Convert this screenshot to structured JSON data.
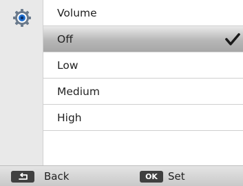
{
  "menu": {
    "title": "Volume",
    "options": [
      {
        "label": "Off",
        "selected": true
      },
      {
        "label": "Low",
        "selected": false
      },
      {
        "label": "Medium",
        "selected": false
      },
      {
        "label": "High",
        "selected": false
      }
    ],
    "category_icon": "settings-icon"
  },
  "footer": {
    "back_key_icon": "return-arrow-icon",
    "back_label": "Back",
    "ok_key_text": "OK",
    "set_label": "Set"
  },
  "colors": {
    "selected_highlight": "#b7b7b7",
    "icon_column": "#e9e9e9",
    "key_background": "#404040"
  }
}
